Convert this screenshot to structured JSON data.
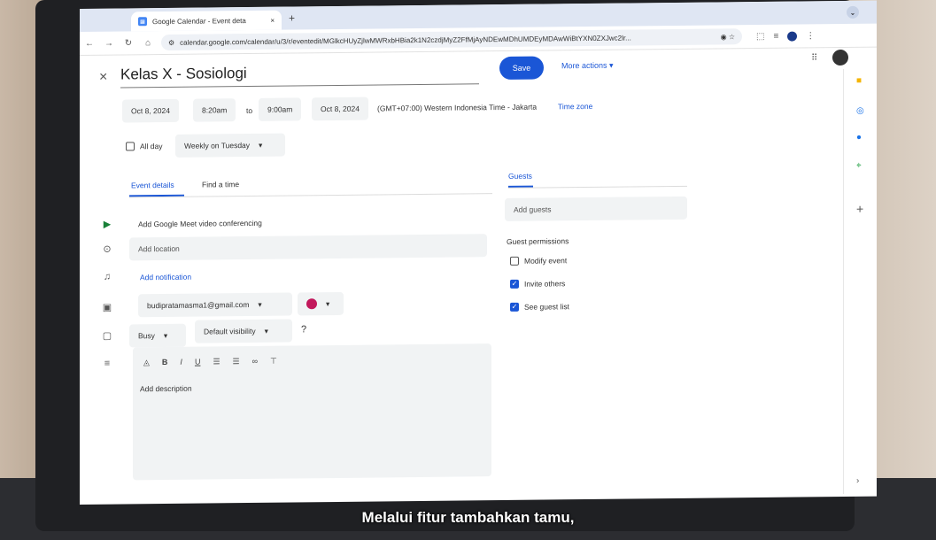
{
  "browser": {
    "tab_title": "Google Calendar - Event deta",
    "tab_close": "×",
    "new_tab": "+",
    "url": "calendar.google.com/calendar/u/3/r/eventedit/MGlkcHUyZjlwMWRxbHBia2k1N2czdjMyZ2FfMjAyNDEwMDhUMDEyMDAwWiBtYXN0ZXJwc2lr..."
  },
  "event": {
    "close": "×",
    "title": "Kelas X - Sosiologi",
    "save_label": "Save",
    "more_actions": "More actions",
    "start_date": "Oct 8, 2024",
    "start_time": "8:20am",
    "to": "to",
    "end_time": "9:00am",
    "end_date": "Oct 8, 2024",
    "timezone_text": "(GMT+07:00) Western Indonesia Time - Jakarta",
    "timezone_link": "Time zone",
    "all_day": "All day",
    "recurrence": "Weekly on Tuesday"
  },
  "tabs": {
    "event_details": "Event details",
    "find_time": "Find a time",
    "guests": "Guests"
  },
  "details": {
    "meet": "Add Google Meet video conferencing",
    "location_placeholder": "Add location",
    "notification": "Add notification",
    "calendar_owner": "budipratamasma1@gmail.com",
    "event_color": "#c2185b",
    "busy": "Busy",
    "visibility": "Default visibility",
    "description_placeholder": "Add description"
  },
  "guests": {
    "add_placeholder": "Add guests",
    "permissions_title": "Guest permissions",
    "permissions": [
      {
        "label": "Modify event",
        "checked": false
      },
      {
        "label": "Invite others",
        "checked": true
      },
      {
        "label": "See guest list",
        "checked": true
      }
    ]
  },
  "subtitle": "Melalui fitur tambahkan tamu,"
}
